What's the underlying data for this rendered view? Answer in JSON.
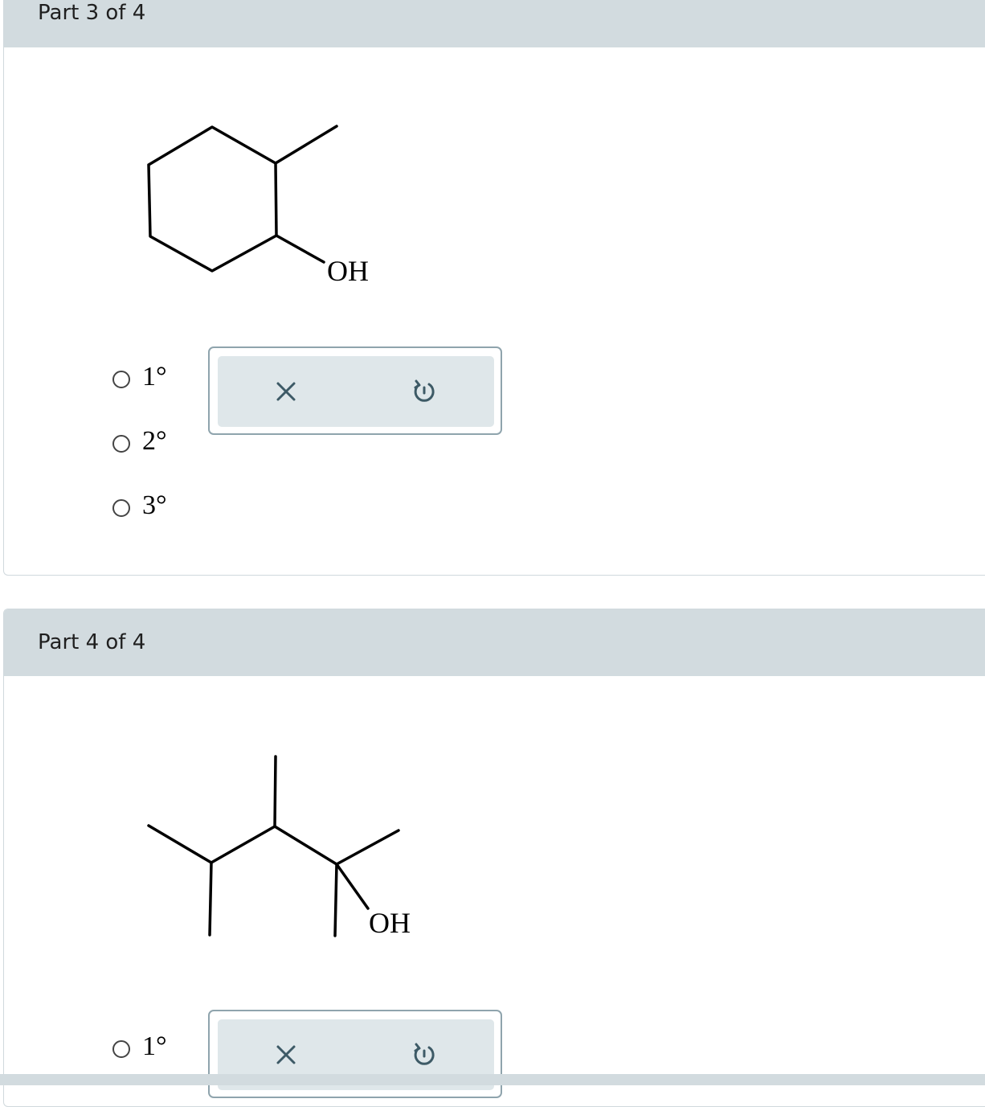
{
  "parts": [
    {
      "title": "Part 3 of 4",
      "structure": {
        "substituent_label": "OH"
      },
      "options": [
        "1°",
        "2°",
        "3°"
      ],
      "toolbox": {
        "clear_icon": "x-icon",
        "reset_icon": "undo-icon"
      }
    },
    {
      "title": "Part 4 of 4",
      "structure": {
        "substituent_label": "OH"
      },
      "options": [
        "1°"
      ],
      "toolbox": {
        "clear_icon": "x-icon",
        "reset_icon": "undo-icon"
      }
    }
  ],
  "colors": {
    "header_bg": "#d2dbdf",
    "toolbox_bg": "#dfe7ea",
    "toolbox_border": "#8fa4ad",
    "icon_color": "#3d5a66"
  }
}
